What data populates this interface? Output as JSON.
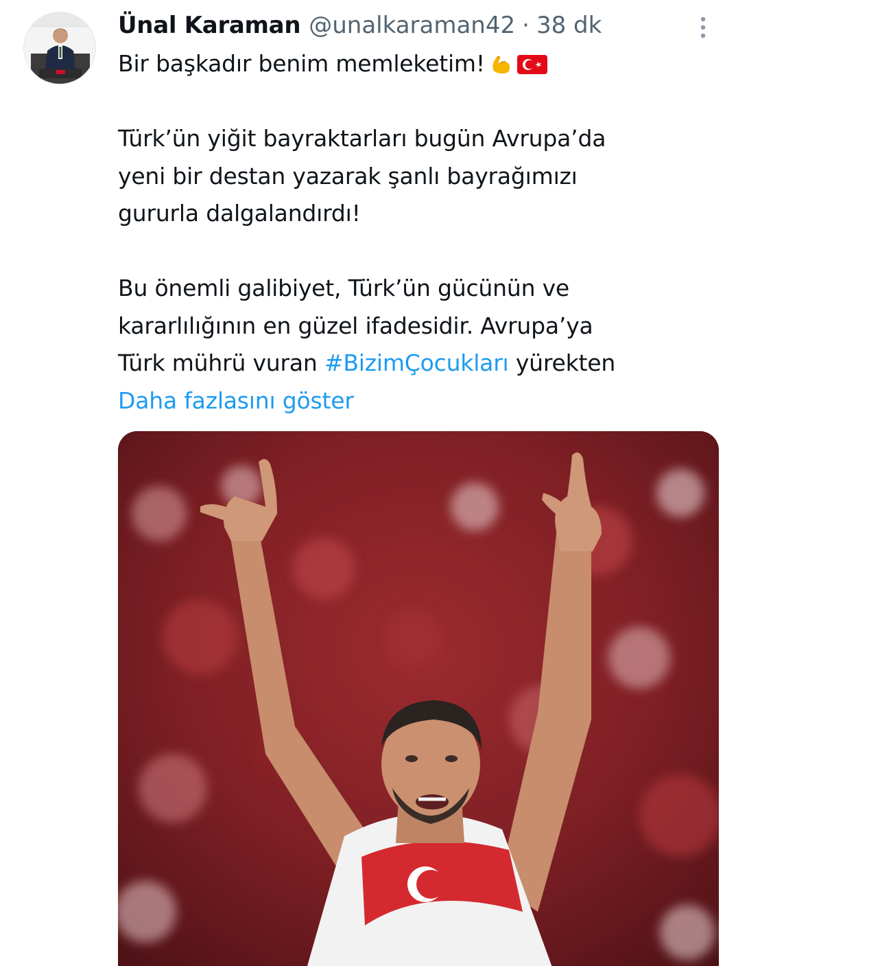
{
  "author": {
    "name": "Ünal Karaman",
    "handle": "@unalkaraman42",
    "separator": "·",
    "time": "38 dk",
    "avatar_icon": "politician-at-podium-avatar"
  },
  "tweet": {
    "line1": "Bir başkadır benim memleketim!",
    "line1_emojis": [
      "flexed-biceps-icon",
      "turkey-flag-icon"
    ],
    "para2": [
      "Türk’ün yiğit bayraktarları bugün Avrupa’da",
      "yeni bir destan yazarak şanlı bayrağımızı",
      "gururla dalgalandırdı!"
    ],
    "para3_line1": "Bu önemli galibiyet, Türk’ün gücünün ve",
    "para3_line2": "kararlılığının en güzel ifadesidir.  Avrupa’ya",
    "para3_line3_before": "Türk mührü vuran ",
    "hashtag": "#BizimÇocukları",
    "para3_line3_after": " yürekten",
    "show_more": "Daha fazlasını göster"
  },
  "media": {
    "description_icon": "football-player-celebrating-photo"
  },
  "colors": {
    "link": "#1d9bf0",
    "muted": "#536471",
    "text": "#0f1419",
    "flag_red": "#e30a17"
  }
}
